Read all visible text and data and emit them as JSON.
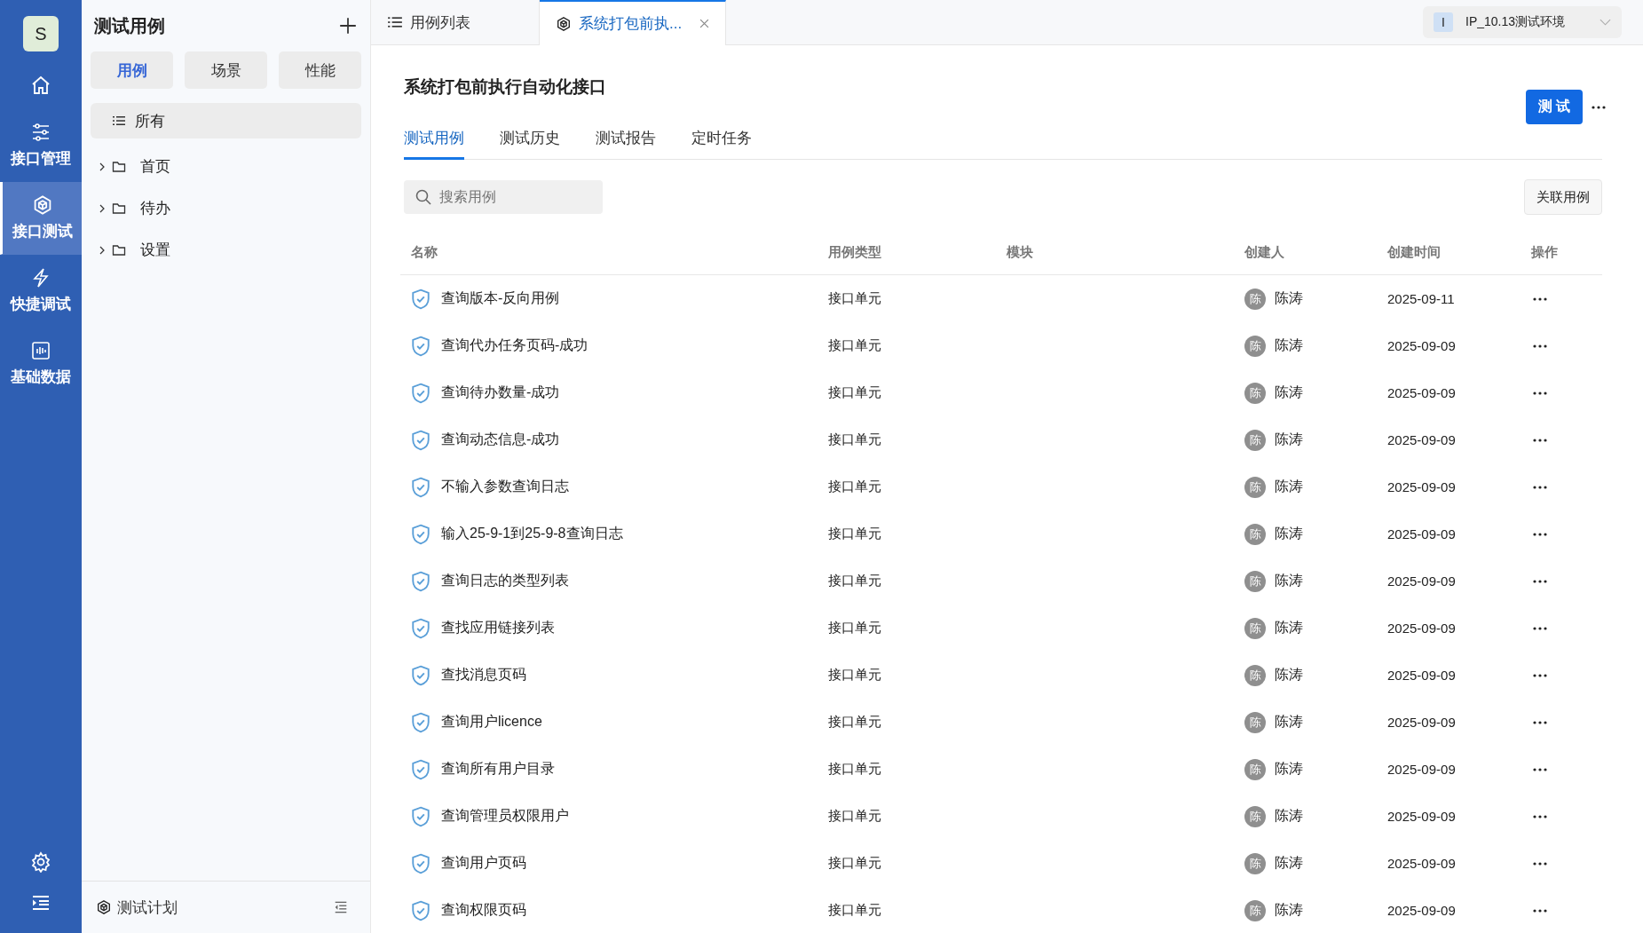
{
  "nav": {
    "avatar": "S",
    "items": [
      {
        "kind": "home",
        "selected": false
      },
      {
        "kind": "sliders",
        "label": "接口管理",
        "selected": false
      },
      {
        "kind": "cube",
        "label": "接口测试",
        "selected": true
      },
      {
        "kind": "bolt",
        "label": "快捷调试",
        "selected": false
      },
      {
        "kind": "chart",
        "label": "基础数据",
        "selected": false
      }
    ]
  },
  "tree_panel": {
    "title": "测试用例",
    "segments": [
      {
        "label": "用例",
        "selected": true
      },
      {
        "label": "场景",
        "selected": false
      },
      {
        "label": "性能",
        "selected": false
      }
    ],
    "all_item": {
      "label": "所有",
      "selected": true
    },
    "folders": [
      {
        "label": "首页",
        "expanded": false
      },
      {
        "label": "待办",
        "expanded": false
      },
      {
        "label": "设置",
        "expanded": false
      }
    ],
    "footer": {
      "label": "测试计划"
    }
  },
  "tabs": [
    {
      "kind": "list",
      "label": "用例列表",
      "selected": false,
      "closable": false
    },
    {
      "kind": "cube",
      "label": "系统打包前执...",
      "selected": true,
      "closable": true
    }
  ],
  "environment": {
    "badge": "I",
    "label": "IP_10.13测试环境"
  },
  "page": {
    "title": "系统打包前执行自动化接口",
    "run_button": "测 试",
    "subtabs": [
      {
        "label": "测试用例",
        "selected": true
      },
      {
        "label": "测试历史",
        "selected": false
      },
      {
        "label": "测试报告",
        "selected": false
      },
      {
        "label": "定时任务",
        "selected": false
      }
    ],
    "search": {
      "placeholder": "搜索用例"
    },
    "link_button": "关联用例"
  },
  "table": {
    "columns": [
      "名称",
      "用例类型",
      "模块",
      "创建人",
      "创建时间",
      "操作"
    ],
    "rows": [
      {
        "name": "查询版本-反向用例",
        "type": "接口单元",
        "avatar": "陈",
        "creator": "陈涛",
        "created": "2025-09-11"
      },
      {
        "name": "查询代办任务页码-成功",
        "type": "接口单元",
        "avatar": "陈",
        "creator": "陈涛",
        "created": "2025-09-09"
      },
      {
        "name": "查询待办数量-成功",
        "type": "接口单元",
        "avatar": "陈",
        "creator": "陈涛",
        "created": "2025-09-09"
      },
      {
        "name": "查询动态信息-成功",
        "type": "接口单元",
        "avatar": "陈",
        "creator": "陈涛",
        "created": "2025-09-09"
      },
      {
        "name": "不输入参数查询日志",
        "type": "接口单元",
        "avatar": "陈",
        "creator": "陈涛",
        "created": "2025-09-09"
      },
      {
        "name": "输入25-9-1到25-9-8查询日志",
        "type": "接口单元",
        "avatar": "陈",
        "creator": "陈涛",
        "created": "2025-09-09"
      },
      {
        "name": "查询日志的类型列表",
        "type": "接口单元",
        "avatar": "陈",
        "creator": "陈涛",
        "created": "2025-09-09"
      },
      {
        "name": "查找应用链接列表",
        "type": "接口单元",
        "avatar": "陈",
        "creator": "陈涛",
        "created": "2025-09-09"
      },
      {
        "name": "查找消息页码",
        "type": "接口单元",
        "avatar": "陈",
        "creator": "陈涛",
        "created": "2025-09-09"
      },
      {
        "name": "查询用户licence",
        "type": "接口单元",
        "avatar": "陈",
        "creator": "陈涛",
        "created": "2025-09-09"
      },
      {
        "name": "查询所有用户目录",
        "type": "接口单元",
        "avatar": "陈",
        "creator": "陈涛",
        "created": "2025-09-09"
      },
      {
        "name": "查询管理员权限用户",
        "type": "接口单元",
        "avatar": "陈",
        "creator": "陈涛",
        "created": "2025-09-09"
      },
      {
        "name": "查询用户页码",
        "type": "接口单元",
        "avatar": "陈",
        "creator": "陈涛",
        "created": "2025-09-09"
      },
      {
        "name": "查询权限页码",
        "type": "接口单元",
        "avatar": "陈",
        "creator": "陈涛",
        "created": "2025-09-09"
      }
    ]
  }
}
